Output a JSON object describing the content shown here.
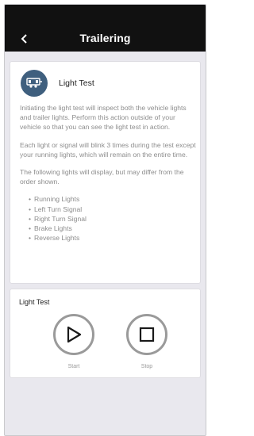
{
  "header": {
    "title": "Trailering",
    "back_icon": "chevron-left-icon"
  },
  "info_card": {
    "icon": "trailer-light-icon",
    "icon_color": "#3f5f7e",
    "title": "Light Test",
    "paragraphs": [
      "Initiating the light test will inspect both the vehicle lights and trailer lights. Perform this action outside of your vehicle so that you can see the light test in action.",
      "Each light or signal will blink 3 times during the test except your running lights, which will remain on the entire time.",
      "The following lights will display, but may differ from the order shown."
    ],
    "lights": [
      "Running Lights",
      "Left Turn Signal",
      "Right Turn Signal",
      "Brake Lights",
      "Reverse Lights"
    ]
  },
  "controls_card": {
    "label": "Light Test",
    "start_label": "Start",
    "stop_label": "Stop"
  }
}
